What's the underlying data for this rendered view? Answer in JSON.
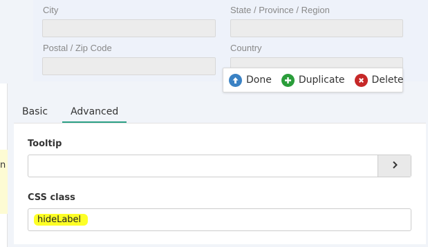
{
  "address_form": {
    "fields": [
      {
        "label": "City",
        "value": ""
      },
      {
        "label": "State / Province / Region",
        "value": ""
      },
      {
        "label": "Postal / Zip Code",
        "value": ""
      },
      {
        "label": "Country",
        "value": ""
      }
    ]
  },
  "actions": {
    "done_label": "Done",
    "duplicate_label": "Duplicate",
    "delete_label": "Delete"
  },
  "left_panel": {
    "partial_text": "n"
  },
  "tabs": [
    {
      "label": "Basic",
      "active": false
    },
    {
      "label": "Advanced",
      "active": true
    }
  ],
  "settings": {
    "tooltip_label": "Tooltip",
    "tooltip_value": "",
    "css_class_label": "CSS class",
    "css_class_value": "hideLabel"
  },
  "colors": {
    "accent": "#2aa084",
    "done": "#3b82c4",
    "duplicate": "#2a9d3a",
    "delete": "#c62828",
    "highlight": "#fdff27"
  }
}
